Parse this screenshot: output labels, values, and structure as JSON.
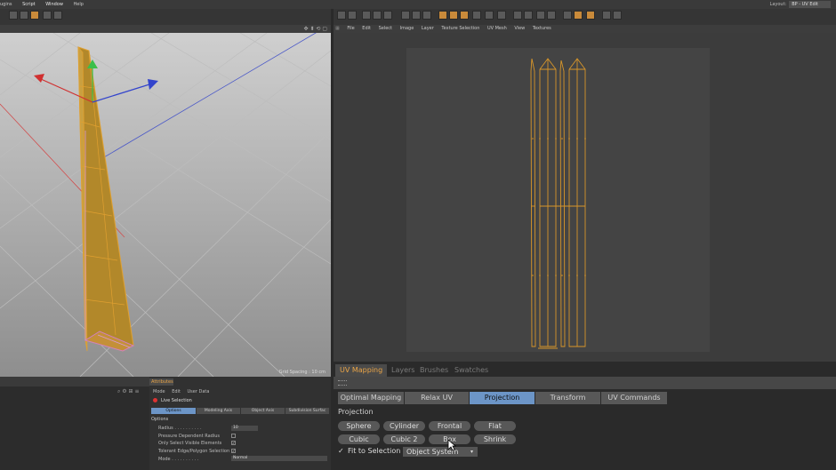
{
  "menubar": {
    "items": [
      "ugins",
      "Script",
      "Window",
      "Help"
    ],
    "highlight_index": 1
  },
  "layout": {
    "label": "Layout:",
    "value": "BP - UV Edit"
  },
  "viewport": {
    "grid_spacing": "Grid Spacing : 10 cm"
  },
  "uv_menu": {
    "items": [
      "File",
      "Edit",
      "Select",
      "Image",
      "Layer",
      "Texture Selection",
      "UV Mesh",
      "View",
      "Textures"
    ]
  },
  "tabs": [
    {
      "label": "UV Mapping",
      "active": true
    },
    {
      "label": "Layers",
      "active": false
    },
    {
      "label": "Brushes",
      "active": false
    },
    {
      "label": "Swatches",
      "active": false
    }
  ],
  "subtabs": [
    {
      "label": "Optimal Mapping",
      "active": false
    },
    {
      "label": "Relax UV",
      "active": false
    },
    {
      "label": "Projection",
      "active": true
    },
    {
      "label": "Transform",
      "active": false
    },
    {
      "label": "UV Commands",
      "active": false
    }
  ],
  "projection": {
    "title": "Projection",
    "row1": [
      "Sphere",
      "Cylinder",
      "Frontal",
      "Flat"
    ],
    "row2": [
      "Cubic",
      "Cubic 2",
      "Box",
      "Shrink"
    ],
    "fit_to_selection": {
      "label": "Fit to Selection",
      "checked": true,
      "check_glyph": "✓"
    },
    "mode": "Object System",
    "dropdown_arrow": "▾"
  },
  "attributes": {
    "title": "Attributes",
    "menu": [
      "Mode",
      "Edit",
      "User Data"
    ],
    "selection": "Live Selection",
    "tabs": [
      {
        "label": "Options",
        "active": true
      },
      {
        "label": "Modeling Axis",
        "active": false
      },
      {
        "label": "Object Axis",
        "active": false
      },
      {
        "label": "Subdivision Surfac",
        "active": false
      }
    ],
    "options_title": "Options",
    "rows": [
      {
        "label": "Radius . . . . . . . . . .",
        "value": "10"
      },
      {
        "label": "Pressure Dependent Radius",
        "value": ""
      },
      {
        "label": "Only Select Visible Elements",
        "value": "✓"
      },
      {
        "label": "Tolerant Edge/Polygon Selection",
        "value": "✓"
      },
      {
        "label": "Mode . . . . . . . . . .",
        "value": "Normal"
      }
    ]
  },
  "colors": {
    "accent_orange": "#e9a447",
    "active_blue": "#6c95c7",
    "uv_wire": "#d8962a"
  }
}
